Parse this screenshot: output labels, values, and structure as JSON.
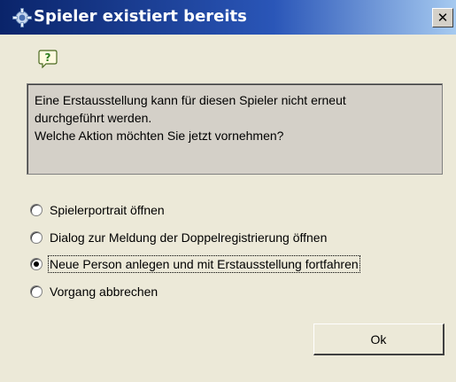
{
  "dialog": {
    "title": "Spieler existiert bereits",
    "close_symbol": "✕",
    "title_icon": "gear-icon",
    "question_icon": "question-icon",
    "message_lines": [
      "Eine Erstausstellung kann für diesen Spieler nicht erneut",
      "durchgeführt werden.",
      "Welche Aktion möchten Sie jetzt vornehmen?"
    ],
    "options": [
      {
        "label": "Spielerportrait öffnen",
        "checked": false
      },
      {
        "label": "Dialog zur Meldung der Doppelregistrierung öffnen",
        "checked": false
      },
      {
        "label": "Neue Person anlegen und mit Erstausstellung fortfahren",
        "checked": true
      },
      {
        "label": "Vorgang abbrechen",
        "checked": false
      }
    ],
    "ok_label": "Ok"
  }
}
